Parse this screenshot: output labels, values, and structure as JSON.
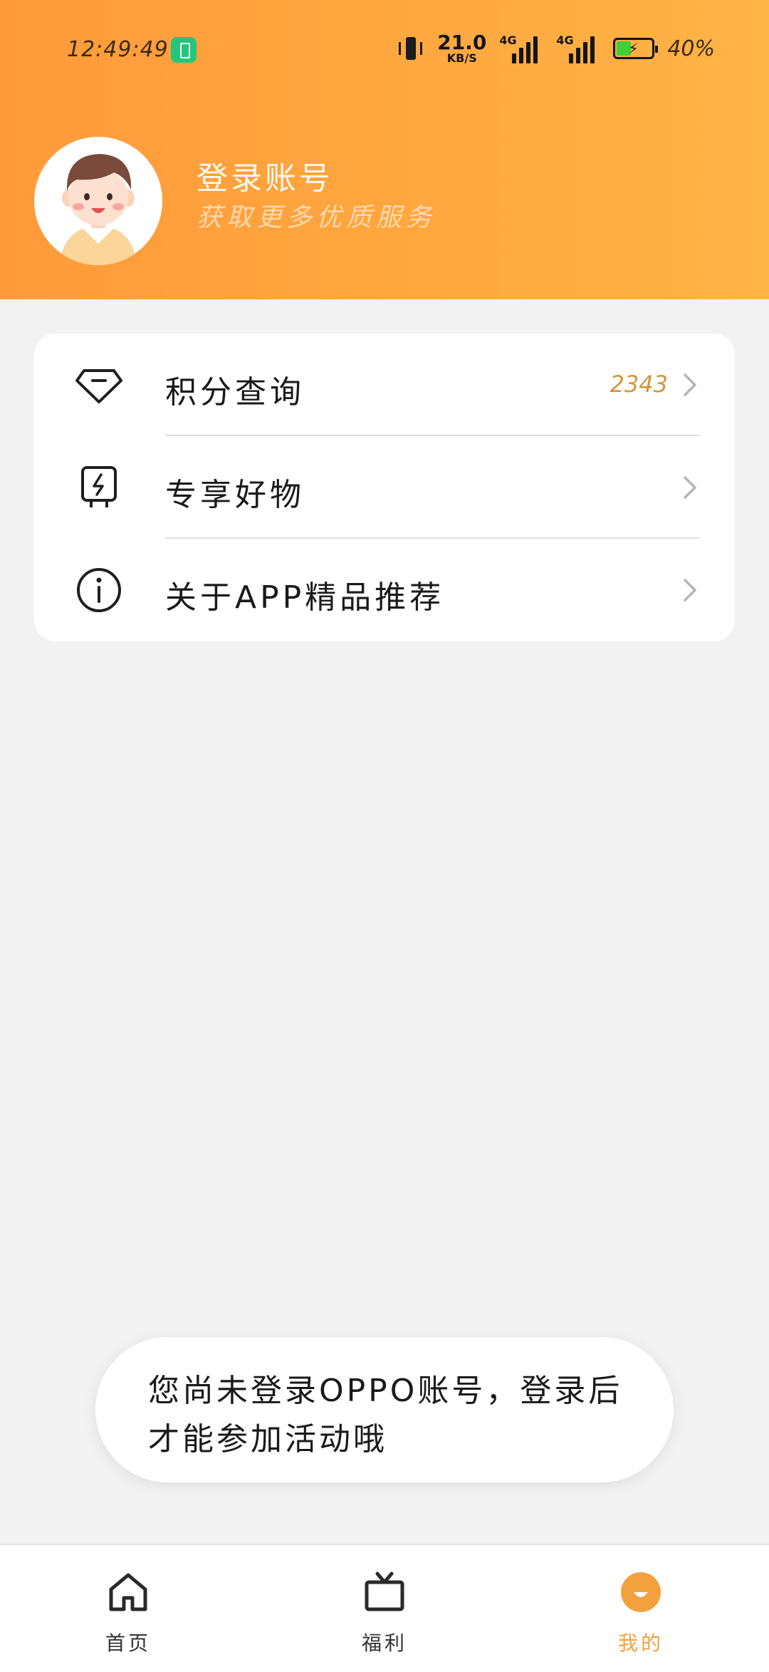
{
  "status_bar": {
    "time": "12:49:49",
    "net_speed_value": "21.0",
    "net_speed_unit": "KB/S",
    "signal_1_label": "4G",
    "signal_2_label": "4G",
    "battery_percent_text": "40%",
    "battery_level": 0.4,
    "charging": true
  },
  "profile": {
    "title": "登录账号",
    "subtitle": "获取更多优质服务"
  },
  "menu": {
    "items": [
      {
        "icon": "diamond-icon",
        "label": "积分查询",
        "value": "2343"
      },
      {
        "icon": "plug-icon",
        "label": "专享好物",
        "value": ""
      },
      {
        "icon": "info-icon",
        "label": "关于APP精品推荐",
        "value": ""
      }
    ]
  },
  "toast": {
    "text": "您尚未登录OPPO账号，登录后才能参加活动哦"
  },
  "bottom_nav": {
    "items": [
      {
        "icon": "home-icon",
        "label": "首页",
        "active": false
      },
      {
        "icon": "tv-icon",
        "label": "福利",
        "active": false
      },
      {
        "icon": "smile-icon",
        "label": "我的",
        "active": true
      }
    ]
  },
  "colors": {
    "header_gradient_start": "#ff9a3a",
    "header_gradient_end": "#ffb446",
    "accent": "#f3a13d",
    "points_value": "#d4953a",
    "background": "#f2f2f2"
  }
}
